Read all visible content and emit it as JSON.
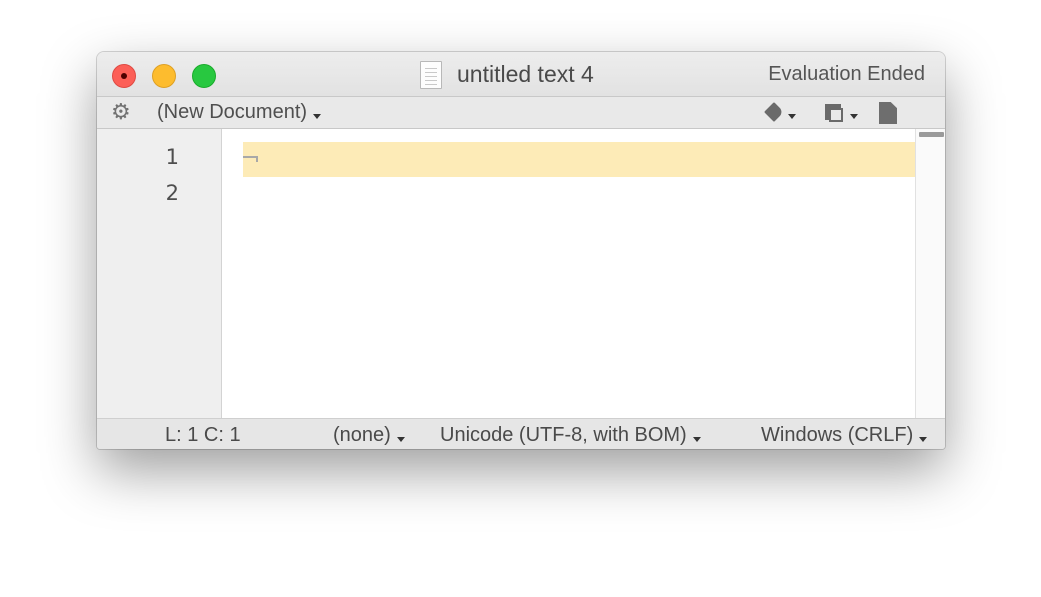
{
  "window": {
    "title": "untitled text 4",
    "evaluation_status": "Evaluation Ended",
    "traffic_lights": {
      "close": "#fc5f57",
      "minimize": "#fdbc2e",
      "zoom": "#28c840"
    }
  },
  "toolbar": {
    "gear_icon": "gear-icon",
    "document_menu_label": "(New Document)",
    "pen_icon": "pen-icon",
    "window_icon": "window-icon",
    "document_icon": "page-icon"
  },
  "editor": {
    "line_numbers": [
      "1",
      "2"
    ],
    "current_line_color": "#fdebb7",
    "line_ending_marker": "line-ending-icon"
  },
  "status": {
    "position": "L: 1 C: 1",
    "language": "(none)",
    "encoding": "Unicode (UTF-8, with BOM)",
    "line_endings": "Windows (CRLF)"
  }
}
